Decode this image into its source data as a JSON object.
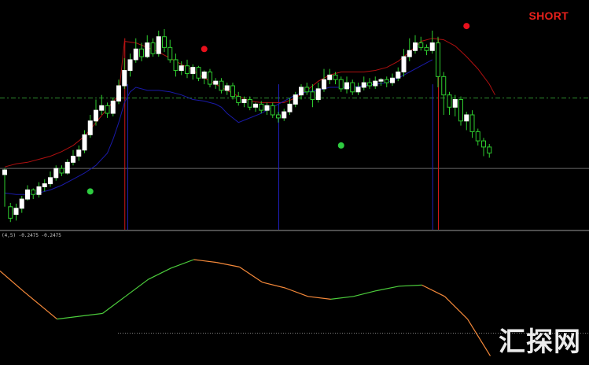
{
  "signal": {
    "label": "SHORT",
    "color": "#e8201c"
  },
  "indicator": {
    "label": "(4,5) -0.2475 -0.2475"
  },
  "watermark": {
    "text": "汇探网"
  },
  "colors": {
    "background": "#000000",
    "bull_candle": "#ffffff",
    "bear_candle": "#ffffff",
    "wick": "#2ecc2e",
    "upper_band": "#b01010",
    "lower_band": "#1a1aa8",
    "level_line": "#2e8b2e",
    "dot_red": "#e8101c",
    "dot_green": "#2ecc40",
    "osc_up": "#4ccd3c",
    "osc_down": "#f5893a"
  },
  "chart_data": [
    {
      "type": "candlestick",
      "title": "",
      "xlabel": "",
      "ylabel": "",
      "ylim": [
        0,
        100
      ],
      "grid": false,
      "candles": [
        [
          72,
          78,
          80,
          30
        ],
        [
          30,
          15,
          35,
          10
        ],
        [
          20,
          28,
          34,
          12
        ],
        [
          28,
          40,
          44,
          22
        ],
        [
          40,
          52,
          58,
          38
        ],
        [
          52,
          46,
          54,
          40
        ],
        [
          46,
          56,
          62,
          42
        ],
        [
          56,
          60,
          66,
          50
        ],
        [
          60,
          68,
          76,
          56
        ],
        [
          68,
          80,
          84,
          64
        ],
        [
          80,
          74,
          84,
          70
        ],
        [
          74,
          88,
          92,
          72
        ],
        [
          88,
          96,
          104,
          84
        ],
        [
          96,
          104,
          110,
          90
        ],
        [
          104,
          124,
          130,
          100
        ],
        [
          124,
          142,
          150,
          120
        ],
        [
          142,
          156,
          170,
          136
        ],
        [
          156,
          162,
          176,
          150
        ],
        [
          162,
          152,
          166,
          146
        ],
        [
          152,
          168,
          172,
          148
        ],
        [
          168,
          188,
          196,
          164
        ],
        [
          188,
          208,
          224,
          184
        ],
        [
          208,
          222,
          230,
          200
        ],
        [
          222,
          236,
          250,
          218
        ],
        [
          236,
          226,
          244,
          220
        ],
        [
          226,
          244,
          254,
          224
        ],
        [
          244,
          230,
          250,
          226
        ],
        [
          230,
          252,
          260,
          226
        ],
        [
          252,
          238,
          262,
          232
        ],
        [
          238,
          222,
          248,
          218
        ],
        [
          222,
          208,
          230,
          200
        ],
        [
          208,
          214,
          220,
          202
        ],
        [
          214,
          204,
          222,
          198
        ],
        [
          204,
          212,
          216,
          196
        ],
        [
          212,
          198,
          214,
          194
        ],
        [
          198,
          206,
          208,
          190
        ],
        [
          206,
          190,
          210,
          186
        ],
        [
          190,
          194,
          198,
          184
        ],
        [
          194,
          182,
          198,
          178
        ],
        [
          182,
          188,
          192,
          176
        ],
        [
          188,
          174,
          192,
          170
        ],
        [
          174,
          166,
          180,
          162
        ],
        [
          166,
          170,
          174,
          160
        ],
        [
          170,
          160,
          174,
          156
        ],
        [
          160,
          164,
          166,
          154
        ],
        [
          164,
          156,
          168,
          152
        ],
        [
          156,
          162,
          166,
          150
        ],
        [
          162,
          150,
          166,
          146
        ],
        [
          150,
          146,
          154,
          140
        ],
        [
          146,
          154,
          158,
          142
        ],
        [
          154,
          164,
          172,
          150
        ],
        [
          164,
          176,
          180,
          160
        ],
        [
          176,
          186,
          190,
          170
        ],
        [
          186,
          180,
          192,
          176
        ],
        [
          180,
          170,
          190,
          160
        ],
        [
          170,
          184,
          192,
          166
        ],
        [
          184,
          196,
          210,
          180
        ],
        [
          196,
          202,
          210,
          190
        ],
        [
          202,
          196,
          206,
          190
        ],
        [
          196,
          184,
          200,
          180
        ],
        [
          184,
          192,
          200,
          178
        ],
        [
          192,
          180,
          196,
          176
        ],
        [
          180,
          186,
          192,
          176
        ],
        [
          186,
          192,
          200,
          182
        ],
        [
          192,
          188,
          198,
          184
        ],
        [
          188,
          194,
          200,
          184
        ],
        [
          194,
          196,
          198,
          188
        ],
        [
          196,
          192,
          200,
          186
        ],
        [
          192,
          198,
          204,
          188
        ],
        [
          198,
          206,
          212,
          194
        ],
        [
          206,
          226,
          236,
          200
        ],
        [
          226,
          234,
          250,
          220
        ],
        [
          234,
          244,
          254,
          230
        ],
        [
          244,
          238,
          252,
          234
        ],
        [
          238,
          234,
          242,
          228
        ],
        [
          234,
          244,
          260,
          230
        ],
        [
          244,
          200,
          252,
          186
        ],
        [
          200,
          176,
          206,
          150
        ],
        [
          176,
          160,
          180,
          150
        ],
        [
          160,
          170,
          176,
          148
        ],
        [
          170,
          142,
          174,
          136
        ],
        [
          142,
          150,
          154,
          130
        ],
        [
          150,
          128,
          156,
          120
        ],
        [
          128,
          116,
          132,
          110
        ],
        [
          116,
          108,
          120,
          96
        ],
        [
          108,
          100,
          112,
          94
        ]
      ],
      "upper_band": [
        [
          0,
          82
        ],
        [
          1,
          84
        ],
        [
          2,
          86
        ],
        [
          4,
          88
        ],
        [
          6,
          92
        ],
        [
          8,
          96
        ],
        [
          10,
          102
        ],
        [
          12,
          110
        ],
        [
          14,
          122
        ],
        [
          16,
          140
        ],
        [
          18,
          158
        ],
        [
          20,
          176
        ],
        [
          21,
          246
        ],
        [
          23,
          244
        ],
        [
          25,
          238
        ],
        [
          27,
          232
        ],
        [
          29,
          224
        ],
        [
          31,
          216
        ],
        [
          33,
          208
        ],
        [
          35,
          198
        ],
        [
          37,
          190
        ],
        [
          39,
          182
        ],
        [
          41,
          174
        ],
        [
          43,
          168
        ],
        [
          45,
          166
        ],
        [
          47,
          166
        ],
        [
          49,
          166
        ],
        [
          51,
          172
        ],
        [
          53,
          182
        ],
        [
          55,
          194
        ],
        [
          57,
          202
        ],
        [
          59,
          206
        ],
        [
          61,
          206
        ],
        [
          63,
          206
        ],
        [
          65,
          208
        ],
        [
          67,
          212
        ],
        [
          69,
          220
        ],
        [
          71,
          232
        ],
        [
          73,
          246
        ],
        [
          75,
          250
        ],
        [
          77,
          248
        ],
        [
          79,
          240
        ],
        [
          81,
          226
        ],
        [
          83,
          210
        ],
        [
          85,
          190
        ],
        [
          86,
          176
        ]
      ],
      "lower_band": [
        [
          0,
          48
        ],
        [
          2,
          46
        ],
        [
          4,
          46
        ],
        [
          6,
          48
        ],
        [
          8,
          52
        ],
        [
          10,
          58
        ],
        [
          12,
          66
        ],
        [
          14,
          74
        ],
        [
          16,
          84
        ],
        [
          18,
          100
        ],
        [
          19,
          118
        ],
        [
          20,
          140
        ],
        [
          21,
          166
        ],
        [
          22,
          180
        ],
        [
          23,
          186
        ],
        [
          24,
          184
        ],
        [
          25,
          182
        ],
        [
          27,
          182
        ],
        [
          29,
          180
        ],
        [
          31,
          176
        ],
        [
          33,
          170
        ],
        [
          35,
          168
        ],
        [
          37,
          164
        ],
        [
          38,
          160
        ],
        [
          39,
          152
        ],
        [
          40,
          146
        ],
        [
          41,
          140
        ],
        [
          43,
          146
        ],
        [
          45,
          152
        ],
        [
          47,
          160
        ],
        [
          49,
          168
        ],
        [
          51,
          176
        ],
        [
          53,
          180
        ],
        [
          55,
          182
        ],
        [
          57,
          186
        ],
        [
          59,
          186
        ],
        [
          61,
          186
        ],
        [
          63,
          188
        ],
        [
          65,
          190
        ],
        [
          67,
          192
        ],
        [
          69,
          198
        ],
        [
          71,
          206
        ],
        [
          73,
          214
        ],
        [
          75,
          222
        ]
      ],
      "level_lines": [
        {
          "value": 172,
          "style": "dash-dot"
        },
        {
          "value": 80,
          "style": "solid"
        }
      ],
      "signal_lines": [
        {
          "index": 21,
          "color": "red"
        },
        {
          "index": 21.5,
          "color": "blue"
        },
        {
          "index": 48,
          "color": "blue"
        },
        {
          "index": 75,
          "color": "blue"
        },
        {
          "index": 76,
          "color": "red"
        }
      ],
      "markers": [
        {
          "index": 15,
          "value": 50,
          "color": "green"
        },
        {
          "index": 35,
          "value": 236,
          "color": "red"
        },
        {
          "index": 59,
          "value": 110,
          "color": "green"
        },
        {
          "index": 81,
          "value": 266,
          "color": "red"
        }
      ]
    },
    {
      "type": "line",
      "title": "",
      "xlabel": "",
      "ylabel": "",
      "ylim": [
        -1,
        1
      ],
      "grid": false,
      "x": [
        0,
        4,
        10,
        14,
        18,
        22,
        26,
        30,
        34,
        38,
        42,
        46,
        50,
        54,
        58,
        62,
        66,
        70,
        74,
        78,
        82,
        86
      ],
      "series": [
        {
          "values": [
            0.55,
            0.2,
            -0.3,
            -0.25,
            -0.2,
            0.1,
            0.4,
            0.6,
            0.75,
            0.7,
            0.62,
            0.35,
            0.25,
            0.1,
            0.05,
            0.1,
            0.2,
            0.28,
            0.3,
            0.1,
            -0.3,
            -0.95
          ]
        }
      ],
      "zero_line": -0.55
    }
  ]
}
